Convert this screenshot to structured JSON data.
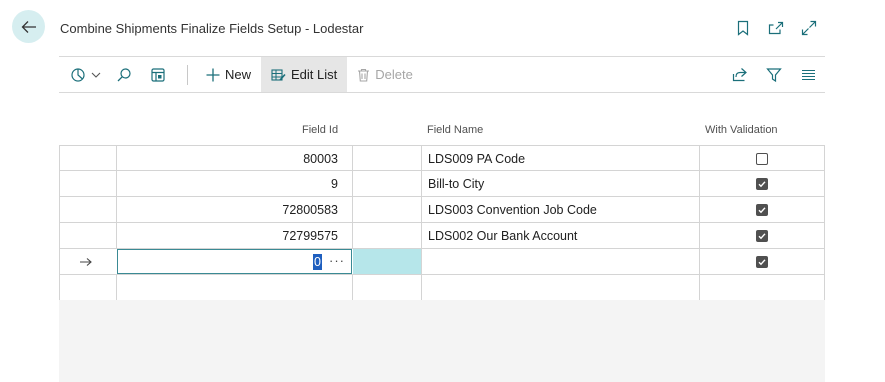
{
  "window": {
    "title": "Combine Shipments Finalize Fields Setup - Lodestar"
  },
  "toolbar": {
    "new_label": "New",
    "edit_list_label": "Edit List",
    "delete_label": "Delete"
  },
  "columns": {
    "field_id": "Field Id",
    "field_name": "Field Name",
    "with_validation": "With Validation"
  },
  "rows": [
    {
      "field_id": "80003",
      "field_name": "LDS009 PA Code",
      "with_validation": false
    },
    {
      "field_id": "9",
      "field_name": "Bill-to City",
      "with_validation": true
    },
    {
      "field_id": "72800583",
      "field_name": "LDS003 Convention Job Code",
      "with_validation": true
    },
    {
      "field_id": "72799575",
      "field_name": "LDS002 Our Bank Account",
      "with_validation": true
    }
  ],
  "new_row": {
    "field_id": "0",
    "with_validation": true,
    "lookup_label": "···"
  },
  "colors": {
    "accent": "#3a8a94",
    "selection": "#1f5fbf",
    "highlight": "#b6e6ea",
    "back_button": "#d6eef0"
  }
}
